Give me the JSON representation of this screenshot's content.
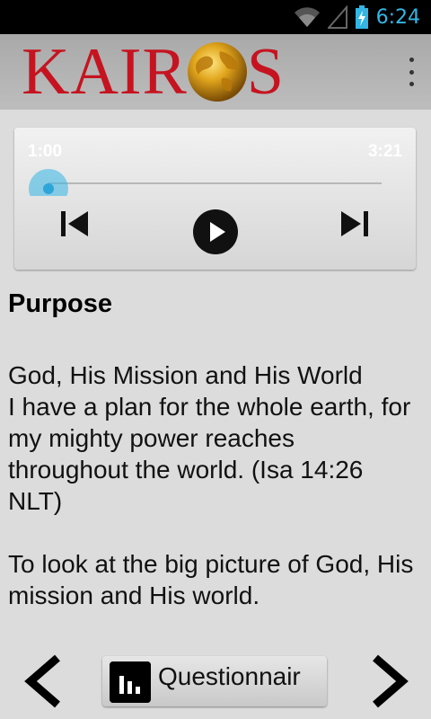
{
  "status_bar": {
    "time": "6:24",
    "icons": [
      "wifi-icon",
      "signal-icon",
      "battery-charging-icon"
    ]
  },
  "app_bar": {
    "logo_text_left": "KAIR",
    "logo_text_right": "S",
    "logo_color": "#c51420",
    "menu_icon": "overflow-menu-icon"
  },
  "player": {
    "current_time": "1:00",
    "total_time": "3:21",
    "progress": 0.0,
    "accent_color": "#33b5e5"
  },
  "content": {
    "heading": "Purpose",
    "paragraph_1": "God, His Mission and His World\nI have a plan for the whole earth, for my mighty power reaches throughout the world. (Isa 14:26 NLT)",
    "paragraph_2": "To look at the big picture of God, His mission and His world."
  },
  "bottom_nav": {
    "prev_icon": "chevron-left-icon",
    "next_icon": "chevron-right-icon",
    "questionnaire_label": "Questionnair",
    "questionnaire_icon": "bar-chart-icon"
  }
}
